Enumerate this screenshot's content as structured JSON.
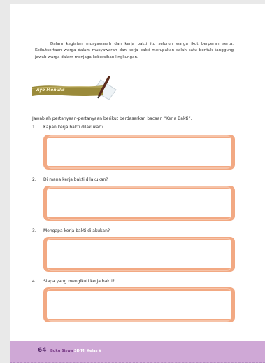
{
  "paragraph": "Dalam kegiatan musyawarah dan kerja bakti itu seluruh warga ikut berperan serta. Keikutsertaan warga dalam musyawarah dan kerja bakti merupakan salah satu bentuk tanggung jawab warga dalam menjaga kebersihan lingkungan.",
  "badge": {
    "label": "Ayo Menulis"
  },
  "instruction": "Jawablah pertanyaan-pertanyaan berikut berdasarkan bacaan “Kerja Bakti”.",
  "questions": [
    {
      "num": "1.",
      "text": "Kapan kerja bakti dilakukan?"
    },
    {
      "num": "2.",
      "text": "Di mana kerja bakti dilakukan?"
    },
    {
      "num": "3.",
      "text": "Mengapa kerja bakti dilakukan?"
    },
    {
      "num": "4.",
      "text": "Siapa yang mengikuti kerja bakti?"
    }
  ],
  "footer": {
    "page_number": "64",
    "book_prefix": "Buku Siswa",
    "book_suffix": "SD/MI Kelas V"
  },
  "colors": {
    "answer_box_border": "#f2a983",
    "footer_band": "#cfa8d6",
    "badge_band": "#9a8a3a"
  }
}
